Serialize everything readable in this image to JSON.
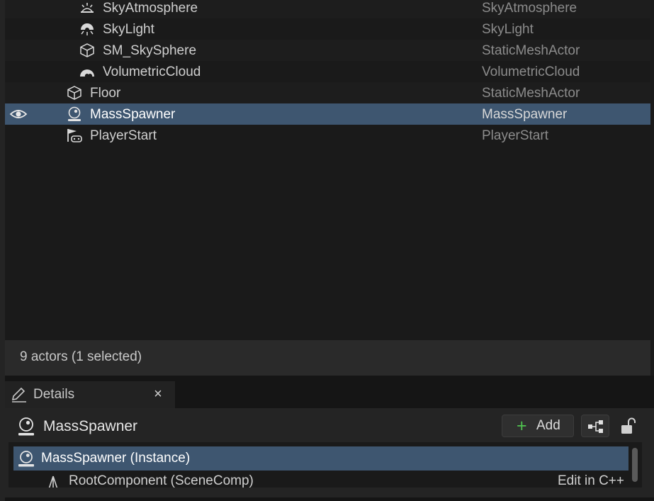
{
  "outliner": {
    "rows": [
      {
        "label": "SkyAtmosphere",
        "type": "SkyAtmosphere",
        "icon": "sky-atmosphere-icon"
      },
      {
        "label": "SkyLight",
        "type": "SkyLight",
        "icon": "skylight-icon"
      },
      {
        "label": "SM_SkySphere",
        "type": "StaticMeshActor",
        "icon": "static-mesh-icon"
      },
      {
        "label": "VolumetricCloud",
        "type": "VolumetricCloud",
        "icon": "cloud-icon"
      },
      {
        "label": "Floor",
        "type": "StaticMeshActor",
        "icon": "static-mesh-icon"
      },
      {
        "label": "MassSpawner",
        "type": "MassSpawner",
        "icon": "actor-icon",
        "selected": true,
        "visibility_icon": "eye-icon"
      },
      {
        "label": "PlayerStart",
        "type": "PlayerStart",
        "icon": "player-start-icon"
      }
    ],
    "status": "9 actors (1 selected)"
  },
  "details": {
    "tab_title": "Details",
    "tab_close": "×",
    "selected_actor": "MassSpawner",
    "add_label": "Add",
    "add_glyph": "+",
    "components": [
      {
        "label": "MassSpawner (Instance)",
        "selected": true
      },
      {
        "label": "RootComponent (SceneComp)",
        "action": "Edit in C++"
      }
    ]
  },
  "colors": {
    "selection": "#3e5670",
    "add_plus": "#4fc24f"
  }
}
